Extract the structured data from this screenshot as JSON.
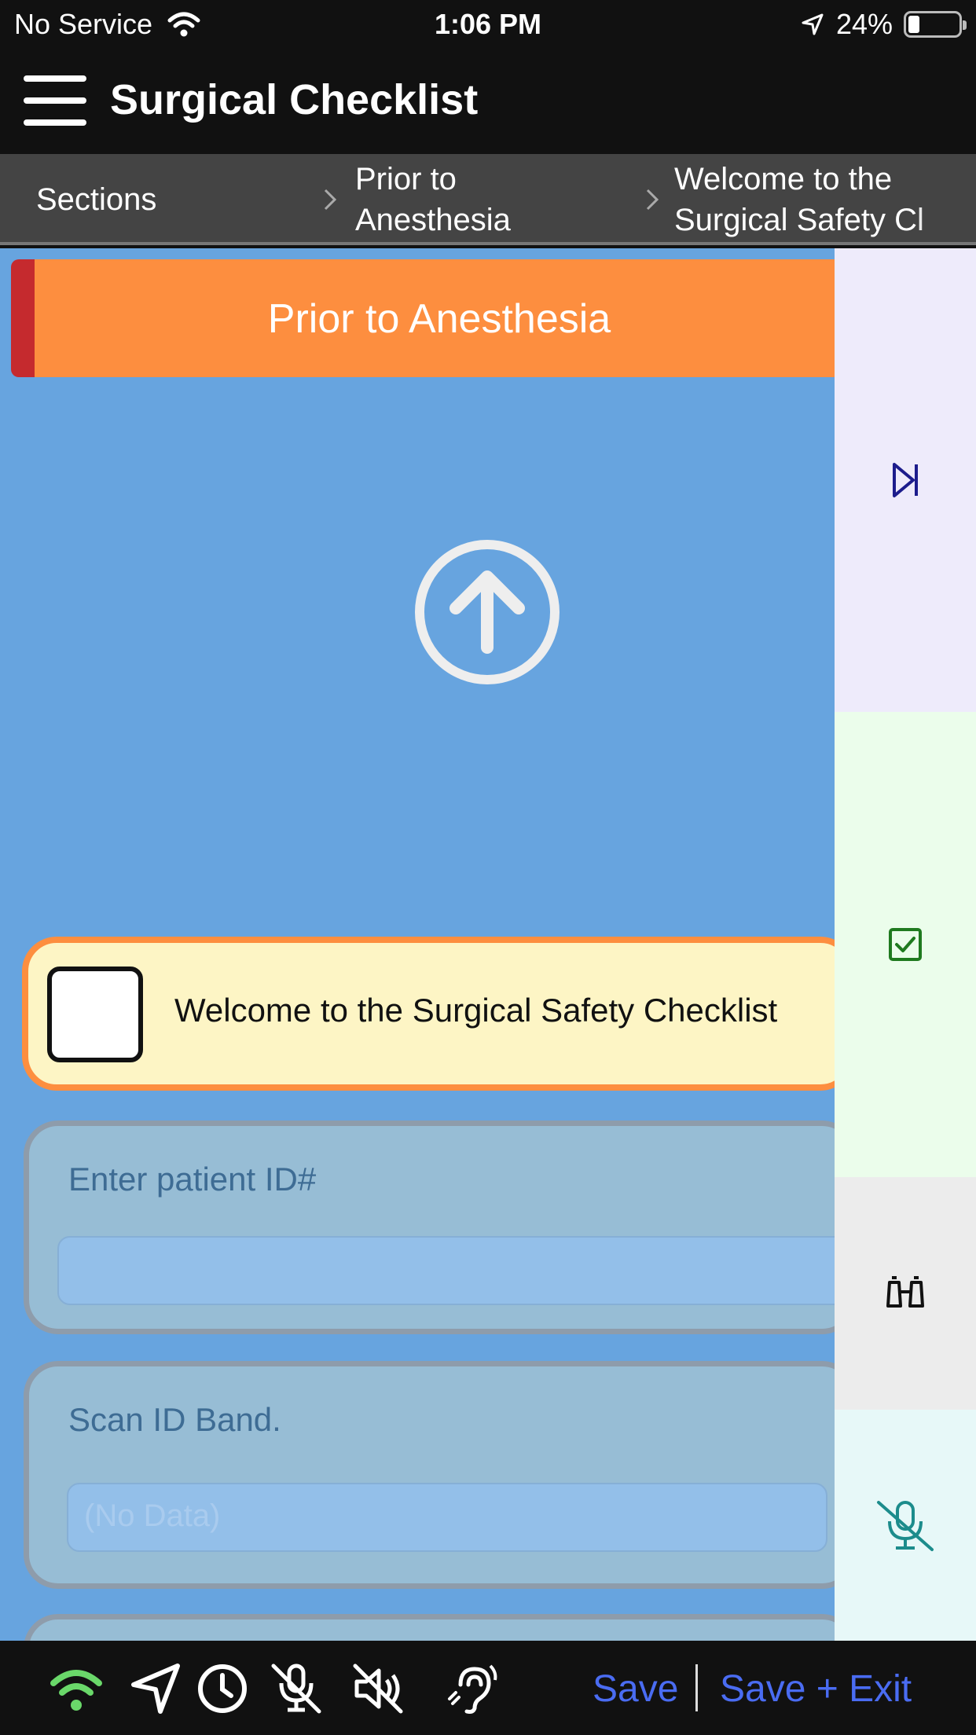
{
  "status_bar": {
    "carrier": "No Service",
    "time": "1:06 PM",
    "battery": "24%",
    "battery_level": 0.24,
    "icons": [
      "wifi-icon",
      "location-arrow-icon",
      "battery-icon"
    ]
  },
  "header": {
    "title": "Surgical Checklist",
    "menu_icon": "hamburger-menu-icon"
  },
  "breadcrumb": {
    "items": [
      "Sections",
      "Prior to Anesthesia",
      "Welcome to the Surgical Safety Checklist"
    ],
    "visible_line_1": [
      "Sections",
      "Prior to",
      "Welcome to the"
    ],
    "visible_line_2": [
      "",
      "Anesthesia",
      "Surgical Safety Cl"
    ]
  },
  "section": {
    "title": "Prior to Anesthesia",
    "accent": "#fd8e3f",
    "marker_color": "#c52a2e",
    "scroll_icon": "arrow-up-circle-icon"
  },
  "checklist": {
    "item_label": "Welcome to the Surgical Safety Checklist",
    "checked": false
  },
  "fields": {
    "patient_id_label": "Enter patient ID#",
    "patient_id_value": "",
    "scan_label": "Scan ID Band.",
    "scan_placeholder": "(No Data)"
  },
  "rail": {
    "buttons": [
      {
        "name": "skip-forward-icon",
        "color": "#1c1c8c",
        "bg": "#eeebfb"
      },
      {
        "name": "checkbox-checked-icon",
        "color": "#1f7a1f",
        "bg": "#ebfdeb"
      },
      {
        "name": "binoculars-icon",
        "color": "#111111",
        "bg": "#ececec"
      },
      {
        "name": "microphone-off-icon",
        "color": "#1c8c8c",
        "bg": "#e7f8f8"
      }
    ]
  },
  "toolbar": {
    "icons": [
      "wifi-icon",
      "location-arrow-icon",
      "clock-icon",
      "microphone-off-icon",
      "speaker-muted-icon",
      "hearing-icon"
    ],
    "save_label": "Save",
    "save_exit_label": "Save + Exit",
    "link_color": "#4a6cf2"
  }
}
